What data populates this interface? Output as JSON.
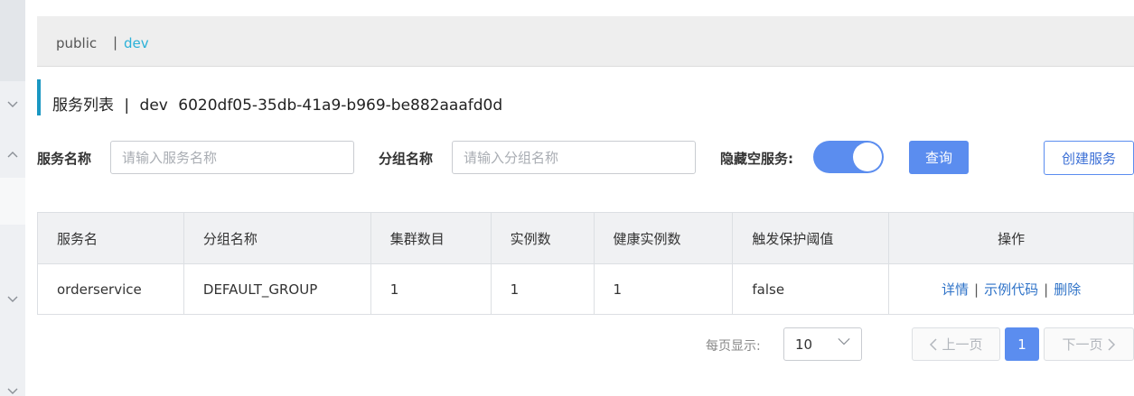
{
  "sidebar": {
    "icons": [
      "chevron-down-icon",
      "chevron-up-icon",
      "chevron-down-icon",
      "chevron-down-icon"
    ]
  },
  "namespaces": {
    "items": [
      {
        "label": "public"
      },
      {
        "label": "dev",
        "active": true
      }
    ],
    "separator": "|"
  },
  "title": {
    "text": "服务列表",
    "separator": "|",
    "namespace_name": "dev",
    "namespace_id": "6020df05-35db-41a9-b969-be882aaafd0d"
  },
  "filters": {
    "service_name_label": "服务名称",
    "service_name_placeholder": "请输入服务名称",
    "group_name_label": "分组名称",
    "group_name_placeholder": "请输入分组名称",
    "hide_empty_label": "隐藏空服务:",
    "hide_empty_on": true,
    "query_label": "查询",
    "create_label": "创建服务"
  },
  "table": {
    "headers": [
      "服务名",
      "分组名称",
      "集群数目",
      "实例数",
      "健康实例数",
      "触发保护阈值",
      "操作"
    ],
    "rows": [
      {
        "service": "orderservice",
        "group": "DEFAULT_GROUP",
        "clusters": "1",
        "instances": "1",
        "healthy": "1",
        "threshold": "false",
        "ops": [
          "详情",
          "示例代码",
          "删除"
        ]
      }
    ]
  },
  "pagination": {
    "page_size_label": "每页显示:",
    "page_size": "10",
    "prev_label": "上一页",
    "next_label": "下一页",
    "current_page": "1"
  },
  "colors": {
    "accent": "#5b8def",
    "link": "#2f73c8",
    "namespace_active": "#2bb1d8"
  }
}
